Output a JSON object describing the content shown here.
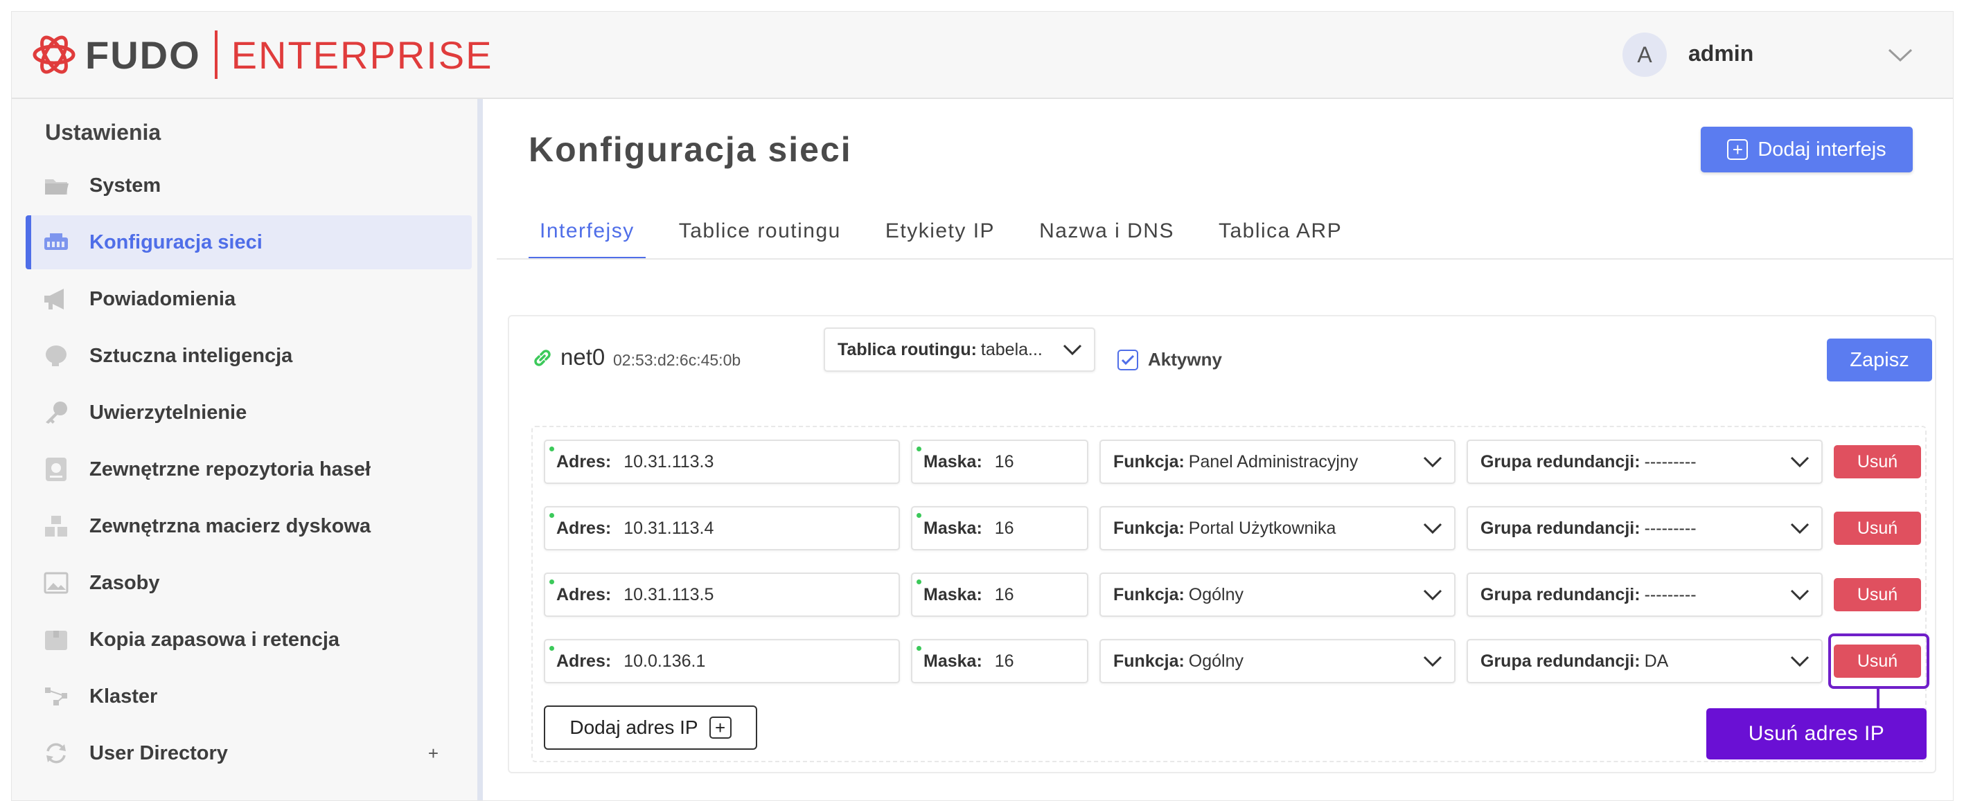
{
  "header": {
    "brand": "FUDO",
    "brand_suffix": "ENTERPRISE",
    "avatar_initial": "A",
    "username": "admin"
  },
  "sidebar": {
    "title": "Ustawienia",
    "items": [
      {
        "label": "System",
        "icon": "folder-icon"
      },
      {
        "label": "Konfiguracja sieci",
        "icon": "network-icon",
        "active": true
      },
      {
        "label": "Powiadomienia",
        "icon": "megaphone-icon"
      },
      {
        "label": "Sztuczna inteligencja",
        "icon": "brain-icon"
      },
      {
        "label": "Uwierzytelnienie",
        "icon": "key-icon"
      },
      {
        "label": "Zewnętrzne repozytoria haseł",
        "icon": "vault-icon"
      },
      {
        "label": "Zewnętrzna macierz dyskowa",
        "icon": "storage-icon"
      },
      {
        "label": "Zasoby",
        "icon": "image-icon"
      },
      {
        "label": "Kopia zapasowa i retencja",
        "icon": "archive-icon"
      },
      {
        "label": "Klaster",
        "icon": "cluster-icon"
      },
      {
        "label": "User Directory",
        "icon": "sync-icon",
        "expand": "+"
      }
    ]
  },
  "main": {
    "title": "Konfiguracja sieci",
    "add_interface_label": "Dodaj interfejs",
    "tabs": [
      {
        "label": "Interfejsy",
        "active": true
      },
      {
        "label": "Tablice routingu"
      },
      {
        "label": "Etykiety IP"
      },
      {
        "label": "Nazwa i DNS"
      },
      {
        "label": "Tablica ARP"
      }
    ]
  },
  "interface": {
    "name": "net0",
    "mac": "02:53:d2:6c:45:0b",
    "routing_label": "Tablica routingu:",
    "routing_value": "tabela...",
    "active_label": "Aktywny",
    "active_checked": true,
    "save_label": "Zapisz",
    "addr_label": "Adres:",
    "mask_label": "Maska:",
    "func_label": "Funkcja:",
    "group_label": "Grupa redundancji:",
    "delete_label": "Usuń",
    "rows": [
      {
        "address": "10.31.113.3",
        "mask": "16",
        "function": "Panel Administracyjny",
        "group": "---------"
      },
      {
        "address": "10.31.113.4",
        "mask": "16",
        "function": "Portal Użytkownika",
        "group": "---------"
      },
      {
        "address": "10.31.113.5",
        "mask": "16",
        "function": "Ogólny",
        "group": "---------"
      },
      {
        "address": "10.0.136.1",
        "mask": "16",
        "function": "Ogólny",
        "group": "DA"
      }
    ],
    "add_ip_label": "Dodaj adres IP"
  },
  "callout": {
    "text": "Usuń adres IP"
  },
  "colors": {
    "accent": "#5b7cf0",
    "danger": "#e0505f",
    "brand_red": "#e03c3c",
    "callout": "#6a10d4"
  }
}
